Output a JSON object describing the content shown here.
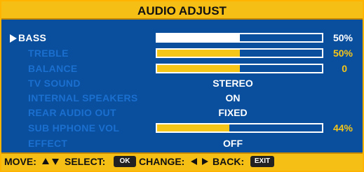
{
  "title": "AUDIO ADJUST",
  "colors": {
    "accent": "#f5bf16",
    "background": "#0a4f9e",
    "inactive_label": "#1b6fcf",
    "highlight": "#ffffff"
  },
  "items": [
    {
      "label": "BASS",
      "kind": "slider",
      "value_text": "50%",
      "level": 0.5,
      "selected": true
    },
    {
      "label": "TREBLE",
      "kind": "slider",
      "value_text": "50%",
      "level": 0.5
    },
    {
      "label": "BALANCE",
      "kind": "slider",
      "value_text": "0",
      "level": 0.5
    },
    {
      "label": "TV SOUND",
      "kind": "option",
      "value_text": "STEREO"
    },
    {
      "label": "INTERNAL SPEAKERS",
      "kind": "option",
      "value_text": "ON"
    },
    {
      "label": "REAR AUDIO OUT",
      "kind": "option",
      "value_text": "FIXED"
    },
    {
      "label": "SUB HPHONE VOL",
      "kind": "slider",
      "value_text": "44%",
      "level": 0.44
    },
    {
      "label": "EFFECT",
      "kind": "option",
      "value_text": "OFF"
    }
  ],
  "footer": {
    "move_label": "MOVE:",
    "select_label": "SELECT:",
    "select_key": "OK",
    "change_label": "CHANGE:",
    "back_label": "BACK:",
    "back_key": "EXIT"
  }
}
